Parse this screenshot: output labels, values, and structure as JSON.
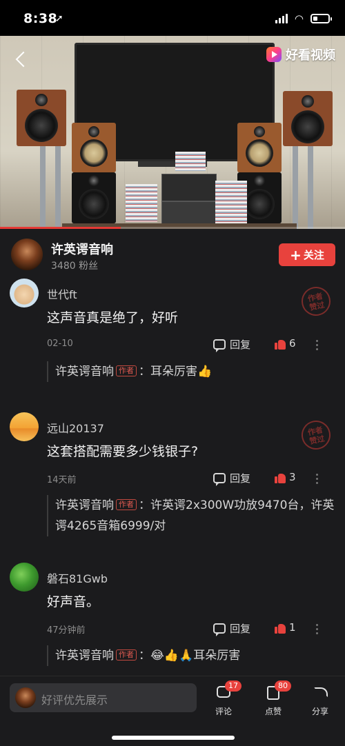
{
  "status": {
    "time": "8:38"
  },
  "video": {
    "brand": "好看视频",
    "progress": 0.35,
    "accent_color": "#e53935"
  },
  "channel": {
    "name": "许英谔音响",
    "fans": "3480 粉丝",
    "follow_label": "关注",
    "follow_color": "#e8423d"
  },
  "comments": [
    {
      "name": "世代ft",
      "text": "这声音真是绝了，好听",
      "time": "02-10",
      "reply_label": "回复",
      "likes": "6",
      "stamp": "作者赞过",
      "author_reply": {
        "author": "许英谔音响",
        "tag": "作者",
        "text": "耳朵厉害👍"
      }
    },
    {
      "name": "远山20137",
      "text": "这套搭配需要多少钱银子?",
      "time": "14天前",
      "reply_label": "回复",
      "likes": "3",
      "stamp": "作者赞过",
      "author_reply": {
        "author": "许英谔音响",
        "tag": "作者",
        "text": "许英谔2x300W功放9470台，许英谔4265音箱6999/对"
      }
    },
    {
      "name": "磐石81Gwb",
      "text": "好声音。",
      "time": "47分钟前",
      "reply_label": "回复",
      "likes": "1",
      "author_reply": {
        "author": "许英谔音响",
        "tag": "作者",
        "text": "😂👍🙏耳朵厉害"
      }
    }
  ],
  "bottom_bar": {
    "input_placeholder": "好评优先展示",
    "comment_label": "评论",
    "comment_count": "17",
    "like_label": "点赞",
    "like_count": "80",
    "share_label": "分享"
  },
  "icons": {
    "back": "back-arrow-icon",
    "reply": "comment-bubble-icon",
    "like": "thumbs-up-icon",
    "more": "more-vertical-icon",
    "share": "share-arrow-icon"
  }
}
